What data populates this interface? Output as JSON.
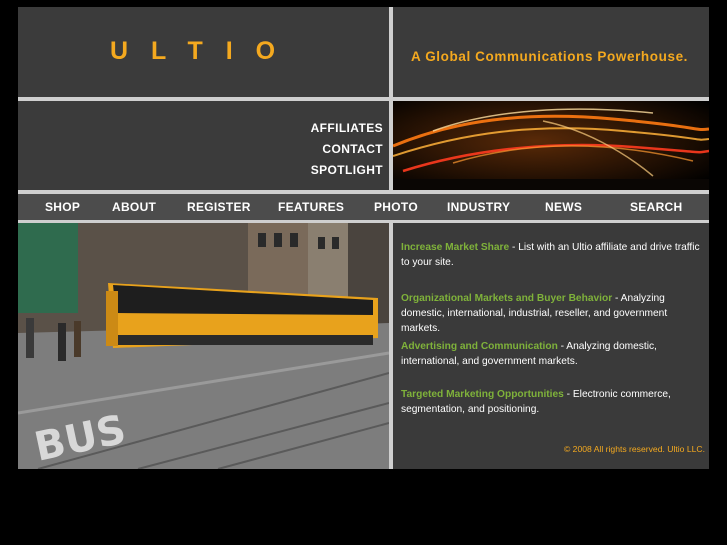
{
  "header": {
    "logo": "ULTIO",
    "tagline": "A Global Communications Powerhouse."
  },
  "side_links": [
    "AFFILIATES",
    "CONTACT",
    "SPOTLIGHT"
  ],
  "menu": [
    "SHOP",
    "ABOUT",
    "REGISTER",
    "FEATURES",
    "PHOTO",
    "INDUSTRY",
    "NEWS",
    "SEARCH"
  ],
  "content": [
    {
      "title": "Increase Market Share",
      "text": " - List with an Ultio affiliate and drive traffic to your site."
    },
    {
      "title": " Organizational Markets and Buyer Behavior",
      "text": " - Analyzing domestic, international, industrial, reseller, and government markets."
    },
    {
      "title": "Advertising and Communication",
      "text": " - Analyzing domestic, international, and government markets."
    },
    {
      "title": "Targeted Marketing Opportunities",
      "text": " - Electronic commerce, segmentation, and positioning."
    }
  ],
  "footer": {
    "copyright": "© 2008 All rights reserved. Ultio LLC."
  },
  "colors": {
    "accent": "#f4a91f",
    "highlight": "#7fb23a",
    "panel": "#3b3b3b"
  }
}
